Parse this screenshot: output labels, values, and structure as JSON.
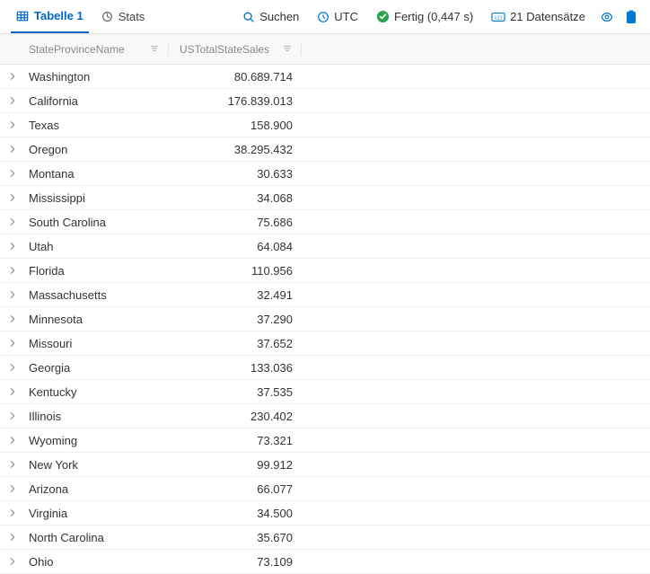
{
  "tabs": {
    "table": "Tabelle 1",
    "stats": "Stats"
  },
  "toolbar": {
    "search": "Suchen",
    "timezone": "UTC",
    "status": "Fertig (0,447 s)",
    "count": "21 Datensätze"
  },
  "columns": {
    "state": "StateProvinceName",
    "sales": "USTotalStateSales"
  },
  "rows": [
    {
      "state": "Washington",
      "sales": "80.689.714"
    },
    {
      "state": "California",
      "sales": "176.839.013"
    },
    {
      "state": "Texas",
      "sales": "158.900"
    },
    {
      "state": "Oregon",
      "sales": "38.295.432"
    },
    {
      "state": "Montana",
      "sales": "30.633"
    },
    {
      "state": "Mississippi",
      "sales": "34.068"
    },
    {
      "state": "South Carolina",
      "sales": "75.686"
    },
    {
      "state": "Utah",
      "sales": "64.084"
    },
    {
      "state": "Florida",
      "sales": "110.956"
    },
    {
      "state": "Massachusetts",
      "sales": "32.491"
    },
    {
      "state": "Minnesota",
      "sales": "37.290"
    },
    {
      "state": "Missouri",
      "sales": "37.652"
    },
    {
      "state": "Georgia",
      "sales": "133.036"
    },
    {
      "state": "Kentucky",
      "sales": "37.535"
    },
    {
      "state": "Illinois",
      "sales": "230.402"
    },
    {
      "state": "Wyoming",
      "sales": "73.321"
    },
    {
      "state": "New York",
      "sales": "99.912"
    },
    {
      "state": "Arizona",
      "sales": "66.077"
    },
    {
      "state": "Virginia",
      "sales": "34.500"
    },
    {
      "state": "North Carolina",
      "sales": "35.670"
    },
    {
      "state": "Ohio",
      "sales": "73.109"
    }
  ]
}
